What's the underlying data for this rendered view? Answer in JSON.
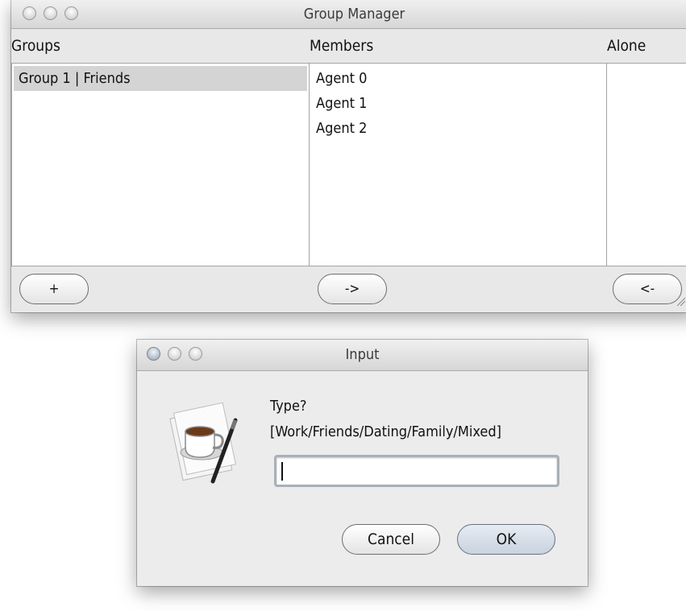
{
  "main_window": {
    "title": "Group Manager",
    "columns": {
      "groups": "Groups",
      "members": "Members",
      "alone": "Alone"
    },
    "groups": [
      "Group 1 | Friends"
    ],
    "members": [
      "Agent 0",
      "Agent 1",
      "Agent 2"
    ],
    "alone": [],
    "buttons": {
      "add": "+",
      "move_right": "->",
      "move_left": "<-"
    }
  },
  "dialog": {
    "title": "Input",
    "prompt": "Type?",
    "options_hint": "[Work/Friends/Dating/Family/Mixed]",
    "input_value": "",
    "cancel_label": "Cancel",
    "ok_label": "OK",
    "icon": "coffee-cup-icon"
  },
  "colors": {
    "selected_row": "#d4d4d4",
    "window_bg": "#e8e8e8",
    "panel_bg": "#ffffff"
  }
}
